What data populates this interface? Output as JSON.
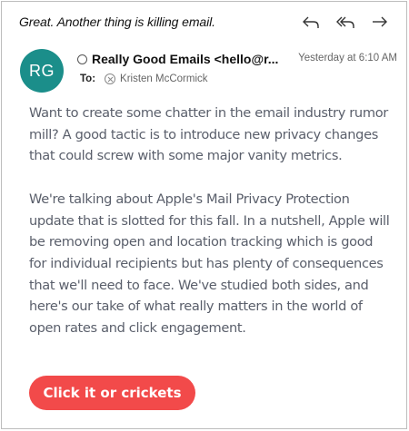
{
  "email": {
    "subject": "Great. Another thing is killing email.",
    "toolbar": {
      "reply_icon": "reply-icon",
      "reply_all_icon": "reply-all-icon",
      "forward_icon": "forward-icon"
    },
    "sender": {
      "avatar_initials": "RG",
      "avatar_color": "#1b8e8a",
      "name": "Really Good Emails <hello@r..."
    },
    "timestamp": "Yesterday at 6:10 AM",
    "to_label": "To:",
    "recipient": "Kristen McCormick",
    "body": {
      "paragraph_1": "Want to create some chatter in the email industry rumor mill? A good tactic is to introduce new privacy changes that could screw with some major vanity metrics.",
      "paragraph_2": "We're talking about Apple's Mail Privacy Protection update that is slotted for this fall. In a nutshell, Apple will be removing open and location tracking which is good for individual recipients but has plenty of consequences that we'll need to face. We've studied both sides, and here's our take of what really matters in the world of open rates and click engagement."
    },
    "cta": {
      "label": "Click it or crickets",
      "color": "#f24a4a"
    }
  }
}
